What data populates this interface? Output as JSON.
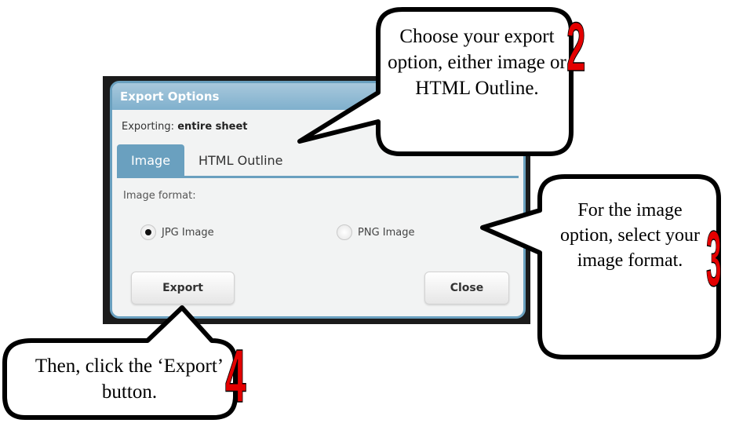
{
  "dialog": {
    "title": "Export Options",
    "exporting_label": "Exporting:",
    "exporting_value": "entire sheet",
    "tabs": [
      {
        "label": "Image",
        "active": true
      },
      {
        "label": "HTML Outline",
        "active": false
      }
    ],
    "image_format_label": "Image format:",
    "formats": [
      {
        "label": "JPG Image",
        "selected": true
      },
      {
        "label": "PNG Image",
        "selected": false
      }
    ],
    "export_button": "Export",
    "close_button": "Close"
  },
  "callouts": [
    {
      "step": "2",
      "text": "Choose your export option, either image or HTML Outline."
    },
    {
      "step": "3",
      "text": "For the image option, select your image format."
    },
    {
      "step": "4",
      "text": "Then, click the ‘Export’ button."
    }
  ],
  "colors": {
    "accent": "#6aa0bf",
    "step_number": "#e40000"
  }
}
